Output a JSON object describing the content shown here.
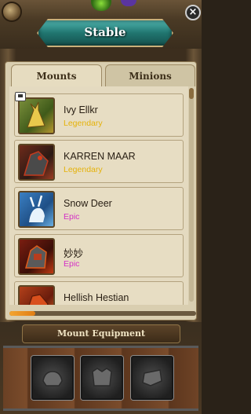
{
  "window": {
    "title": "Stable",
    "close_label": "×"
  },
  "tabs": [
    {
      "label": "Mounts",
      "active": true
    },
    {
      "label": "Minions",
      "active": false
    }
  ],
  "mounts": [
    {
      "name": "Ivy Ellkr",
      "rarity": "Legendary",
      "rarity_color": "#e5b20a",
      "icon": "ivy-elk-portrait-icon",
      "badge": true
    },
    {
      "name": "KARREN MAAR",
      "rarity": "Legendary",
      "rarity_color": "#e5b20a",
      "icon": "karren-maar-portrait-icon",
      "badge": false
    },
    {
      "name": "Snow Deer",
      "rarity": "Epic",
      "rarity_color": "#d42fc6",
      "icon": "snow-deer-portrait-icon",
      "badge": false
    },
    {
      "name": "妙妙",
      "rarity": "Epic",
      "rarity_color": "#d42fc6",
      "icon": "armored-mount-portrait-icon",
      "badge": false
    },
    {
      "name": "Hellish Hestian",
      "rarity": "",
      "rarity_color": "#e5b20a",
      "icon": "hellish-hestian-portrait-icon",
      "badge": false
    }
  ],
  "list_scroll": {
    "position": 0.0
  },
  "horizontal_progress": {
    "value": 0.14
  },
  "equipment": {
    "header": "Mount Equipment",
    "slots": [
      {
        "icon": "saddle-slot-icon"
      },
      {
        "icon": "armor-slot-icon"
      },
      {
        "icon": "horseshoe-slot-icon"
      }
    ]
  }
}
